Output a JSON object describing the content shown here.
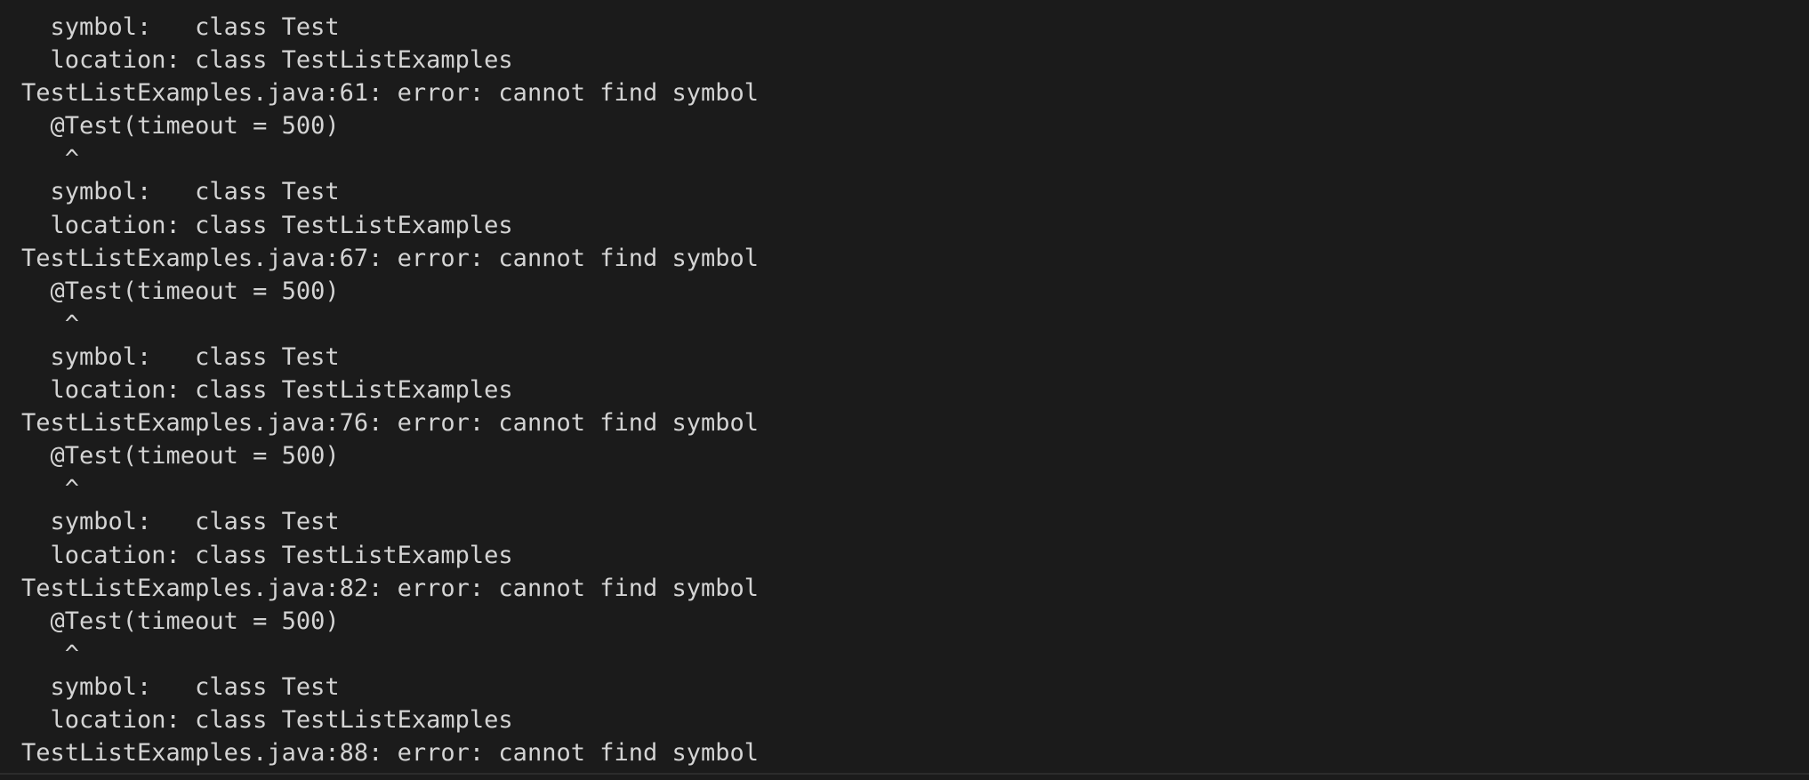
{
  "terminal": {
    "lines": [
      "  symbol:   class Test",
      "  location: class TestListExamples",
      "TestListExamples.java:61: error: cannot find symbol",
      "  @Test(timeout = 500)",
      "   ^",
      "  symbol:   class Test",
      "  location: class TestListExamples",
      "TestListExamples.java:67: error: cannot find symbol",
      "  @Test(timeout = 500)",
      "   ^",
      "  symbol:   class Test",
      "  location: class TestListExamples",
      "TestListExamples.java:76: error: cannot find symbol",
      "  @Test(timeout = 500)",
      "   ^",
      "  symbol:   class Test",
      "  location: class TestListExamples",
      "TestListExamples.java:82: error: cannot find symbol",
      "  @Test(timeout = 500)",
      "   ^",
      "  symbol:   class Test",
      "  location: class TestListExamples",
      "TestListExamples.java:88: error: cannot find symbol"
    ]
  },
  "colors": {
    "background": "#1b1b1b",
    "text": "#d4d4d4"
  }
}
